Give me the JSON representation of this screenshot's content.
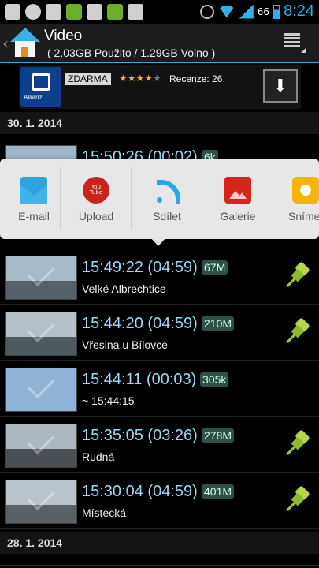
{
  "status_bar": {
    "battery_percent": "66",
    "time": "8:24"
  },
  "action_bar": {
    "back_glyph": "‹",
    "title": "Video",
    "subtitle": "( 2.03GB Použito / 1.29GB Volno )"
  },
  "ad": {
    "brand": "Allianz",
    "badge": "ZDARMA",
    "rating_stars": 4,
    "rating_max": 5,
    "reviews": "Recenze: 26",
    "download_glyph": "⬇"
  },
  "share_popup": {
    "items": [
      {
        "label": "E-mail",
        "icon": "mail-icon"
      },
      {
        "label": "Upload",
        "icon": "youtube-icon"
      },
      {
        "label": "Sdílet",
        "icon": "rss-share-icon"
      },
      {
        "label": "Galerie",
        "icon": "gallery-icon"
      },
      {
        "label": "Snímek",
        "icon": "camera-icon"
      }
    ]
  },
  "sections": [
    {
      "date": "30. 1. 2014"
    },
    {
      "date": "28. 1. 2014"
    }
  ],
  "partial_row": {
    "time": "15:50:26 (00:02)",
    "size": "6k"
  },
  "videos": [
    {
      "time": "15:49:22 (04:59)",
      "size": "67M",
      "place": "Velké Albrechtice",
      "pinned": true
    },
    {
      "time": "15:44:20 (04:59)",
      "size": "210M",
      "place": "Vřesina u Bílovce",
      "pinned": true
    },
    {
      "time": "15:44:11 (00:03)",
      "size": "305k",
      "place": "~ 15:44:15",
      "pinned": false
    },
    {
      "time": "15:35:05 (03:26)",
      "size": "278M",
      "place": "Rudná",
      "pinned": true
    },
    {
      "time": "15:30:04 (04:59)",
      "size": "401M",
      "place": "Místecká",
      "pinned": true
    }
  ],
  "colors": {
    "accent": "#3aa4d9",
    "time_text": "#9ad7f2",
    "pin": "#9cc63a"
  }
}
